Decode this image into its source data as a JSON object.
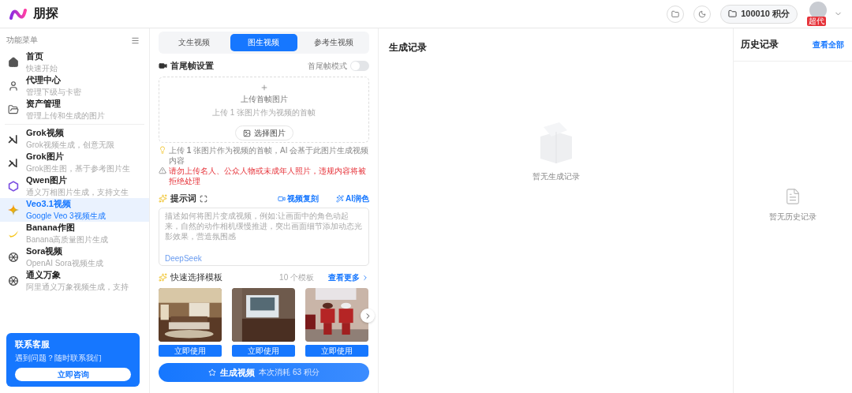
{
  "header": {
    "brand": "朋探",
    "points": "100010 积分",
    "badge": "超代"
  },
  "sidebar": {
    "title": "功能菜单",
    "items": [
      {
        "title": "首页",
        "subtitle": "快速开始",
        "selected": false
      },
      {
        "title": "代理中心",
        "subtitle": "管理下级与卡密",
        "selected": false
      },
      {
        "title": "资产管理",
        "subtitle": "管理上传和生成的图片",
        "selected": false
      },
      {
        "title": "Grok视频",
        "subtitle": "Grok视频生成，创意无限",
        "selected": false
      },
      {
        "title": "Grok图片",
        "subtitle": "Grok图生图，基于参考图片生",
        "selected": false
      },
      {
        "title": "Qwen图片",
        "subtitle": "通义万相图片生成，支持文生",
        "selected": false
      },
      {
        "title": "Veo3.1视频",
        "subtitle": "Google Veo 3视频生成",
        "selected": true
      },
      {
        "title": "Banana作图",
        "subtitle": "Banana高质量图片生成",
        "selected": false
      },
      {
        "title": "Sora视频",
        "subtitle": "OpenAI Sora视频生成",
        "selected": false
      },
      {
        "title": "通义万象",
        "subtitle": "阿里通义万象视频生成，支持",
        "selected": false
      }
    ],
    "contact": {
      "title": "联系客服",
      "text": "遇到问题？随时联系我们",
      "button": "立即咨询"
    }
  },
  "form": {
    "tabs": [
      {
        "label": "文生视频",
        "selected": false
      },
      {
        "label": "图生视频",
        "selected": true
      },
      {
        "label": "参考生视频",
        "selected": false
      }
    ],
    "frames": {
      "title": "首尾帧设置",
      "toggle_label": "首尾帧模式",
      "toggle_on": false,
      "upload_title": "上传首帧图片",
      "upload_hint": "上传 1 张图片作为视频的首帧",
      "choose": "选择图片"
    },
    "note": "上传 **1** 张图片作为视频的首帧，AI 会基于此图片生成视频内容",
    "warning": "请勿上传名人、公众人物或未成年人照片，违规内容将被拒绝处理",
    "prompt": {
      "title": "提示词",
      "action_1": "视频复刻",
      "action_2": "AI润色",
      "placeholder": "描述如何将图片变成视频，例如:让画面中的角色动起来，自然的动作相机缓慢推进，突出画面细节添加动态光影效果，营造氛围感",
      "engine": "DeepSeek"
    },
    "templates": {
      "title": "快速选择模板",
      "count": "10 个模板",
      "more": "查看更多",
      "items": [
        {
          "kind": "bedroom",
          "button": "立即使用"
        },
        {
          "kind": "room",
          "button": "立即使用"
        },
        {
          "kind": "people",
          "button": "立即使用"
        }
      ]
    },
    "generate": {
      "label": "生成视频",
      "cost": "本次消耗 63 积分"
    }
  },
  "results": {
    "title": "生成记录",
    "empty": "暂无生成记录"
  },
  "history": {
    "title": "历史记录",
    "link": "查看全部",
    "empty": "暂无历史记录"
  }
}
